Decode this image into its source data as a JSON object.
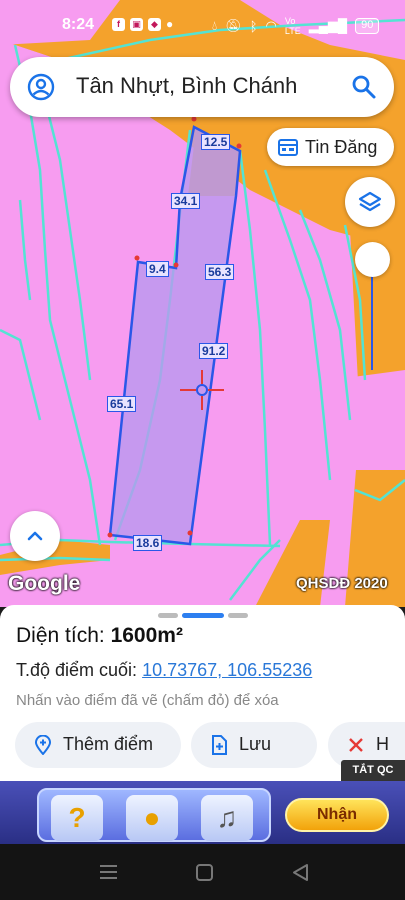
{
  "status_bar": {
    "time": "8:24",
    "battery": "90",
    "icons": [
      "facebook-icon",
      "app-icon",
      "shield-icon",
      "dot-icon",
      "water-icon",
      "mute-icon",
      "bluetooth-icon",
      "wifi-icon",
      "volte-icon",
      "signal-icon",
      "battery-icon"
    ]
  },
  "search": {
    "query": "Tân Nhựt, Bình Chánh"
  },
  "map": {
    "tin_dang_label": "Tin Đăng",
    "attribution": "Google",
    "layer_label": "QHSDĐ 2020",
    "colors": {
      "residential": "#f79cf0",
      "road": "#f4a22c",
      "road_tan": "#d99a66",
      "boundary": "#54e3d3",
      "parcel_fill": "#b998ee",
      "parcel_stroke": "#2a57e8",
      "vertex": "#e53935"
    },
    "measurements": [
      "12.5",
      "34.1",
      "9.4",
      "56.3",
      "91.2",
      "65.1",
      "18.6"
    ]
  },
  "result": {
    "area_label": "Diện tích:",
    "area_value": "1600m²",
    "coord_label": "T.độ điểm cuối:",
    "coord_value": "10.73767, 106.55236",
    "hint": "Nhấn vào điểm đã vẽ (chấm đỏ) để xóa",
    "actions": [
      "Thêm điểm",
      "Lưu",
      "H"
    ]
  },
  "ad": {
    "tag": "TẮT QC",
    "button": "Nhận"
  }
}
